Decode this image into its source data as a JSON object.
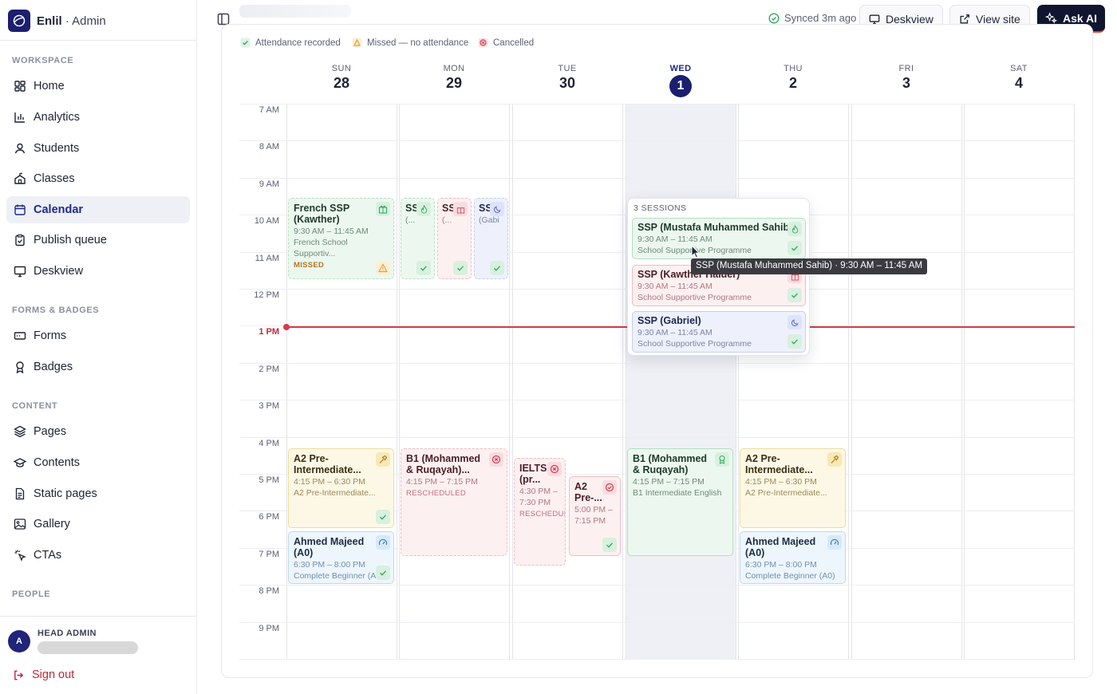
{
  "brand": {
    "org": "Enlil",
    "suffix": " · Admin"
  },
  "sidebar": {
    "sections": [
      {
        "label": "WORKSPACE",
        "items": [
          {
            "label": "Home",
            "icon": "home-grid-icon"
          },
          {
            "label": "Analytics",
            "icon": "bar-chart-icon"
          },
          {
            "label": "Students",
            "icon": "user-icon"
          },
          {
            "label": "Classes",
            "icon": "school-icon"
          },
          {
            "label": "Calendar",
            "icon": "calendar-icon",
            "active": true
          },
          {
            "label": "Publish queue",
            "icon": "clipboard-icon"
          },
          {
            "label": "Deskview",
            "icon": "monitor-icon"
          }
        ]
      },
      {
        "label": "FORMS & BADGES",
        "items": [
          {
            "label": "Forms",
            "icon": "form-icon"
          },
          {
            "label": "Badges",
            "icon": "badge-icon"
          }
        ]
      },
      {
        "label": "CONTENT",
        "items": [
          {
            "label": "Pages",
            "icon": "layers-icon"
          },
          {
            "label": "Contents",
            "icon": "graduation-cap-icon"
          },
          {
            "label": "Static pages",
            "icon": "file-icon"
          },
          {
            "label": "Gallery",
            "icon": "image-icon"
          },
          {
            "label": "CTAs",
            "icon": "sparkle-click-icon"
          }
        ]
      },
      {
        "label": "PEOPLE",
        "items": []
      }
    ],
    "user": {
      "role": "HEAD ADMIN",
      "initial": "A"
    },
    "signout": "Sign out"
  },
  "topbar": {
    "synced": "Synced 3m ago",
    "deskview": "Deskview",
    "view_site": "View site",
    "ask_ai": "Ask AI"
  },
  "legend": [
    {
      "label": "Attendance recorded",
      "color": "#3aa860"
    },
    {
      "label": "Missed — no attendance",
      "color": "#e2a23a"
    },
    {
      "label": "Cancelled",
      "color": "#d63a4a"
    }
  ],
  "days": [
    {
      "name": "SUN",
      "num": "28"
    },
    {
      "name": "MON",
      "num": "29"
    },
    {
      "name": "TUE",
      "num": "30"
    },
    {
      "name": "WED",
      "num": "1",
      "today": true
    },
    {
      "name": "THU",
      "num": "2"
    },
    {
      "name": "FRI",
      "num": "3"
    },
    {
      "name": "SAT",
      "num": "4"
    }
  ],
  "hours": [
    "7 AM",
    "8 AM",
    "9 AM",
    "10 AM",
    "11 AM",
    "12 PM",
    "1 PM",
    "2 PM",
    "3 PM",
    "4 PM",
    "5 PM",
    "6 PM",
    "7 PM",
    "8 PM",
    "9 PM"
  ],
  "now_label": "1 PM",
  "events": {
    "french": {
      "title": "French SSP (Kawther)",
      "time": "9:30 AM – 11:45 AM",
      "sub": "French School Supportiv...",
      "status": "MISSED"
    },
    "mon_ssp1": {
      "title": "SS",
      "sub": "(..."
    },
    "mon_ssp2": {
      "title": "SS",
      "sub": "(..."
    },
    "mon_ssp3": {
      "title": "SS",
      "sub": "(Gabi"
    },
    "sun_a2": {
      "title": "A2 Pre-Intermediate...",
      "time": "4:15 PM – 6:30 PM",
      "sub": "A2 Pre-Intermediate..."
    },
    "sun_ahmed": {
      "title": "Ahmed Majeed (A0)",
      "time": "6:30 PM – 8:00 PM",
      "sub": "Complete Beginner (A("
    },
    "mon_b1": {
      "title": "B1 (Mohammed & Ruqayah)...",
      "time": "4:15 PM – 7:15 PM",
      "status": "RESCHEDULED"
    },
    "tue_ielts": {
      "title": "IELTS (pr...",
      "time": "4:30 PM – 7:30 PM",
      "status": "RESCHEDULEI"
    },
    "tue_a2": {
      "title": "A2 Pre-...",
      "time": "5:00 PM – 7:15 PM"
    },
    "wed_b1": {
      "title": "B1 (Mohammed & Ruqayah)",
      "time": "4:15 PM – 7:15 PM",
      "sub": "B1 Intermediate English"
    },
    "thu_a2": {
      "title": "A2 Pre-Intermediate...",
      "time": "4:15 PM – 6:30 PM",
      "sub": "A2 Pre-Intermediate..."
    },
    "thu_ahmed": {
      "title": "Ahmed Majeed (A0)",
      "time": "6:30 PM – 8:00 PM",
      "sub": "Complete Beginner (A0)"
    }
  },
  "popover": {
    "title": "3 SESSIONS",
    "items": [
      {
        "title": "SSP (Mustafa Muhammed Sahib)",
        "time": "9:30 AM – 11:45 AM",
        "sub": "School Supportive Programme"
      },
      {
        "title": "SSP (Kawther Haider)",
        "time": "9:30 AM – 11:45 AM",
        "sub": "School Supportive Programme"
      },
      {
        "title": "SSP (Gabriel)",
        "time": "9:30 AM – 11:45 AM",
        "sub": "School Supportive Programme"
      }
    ]
  },
  "tooltip": "SSP (Mustafa Muhammed Sahib) · 9:30 AM – 11:45 AM"
}
